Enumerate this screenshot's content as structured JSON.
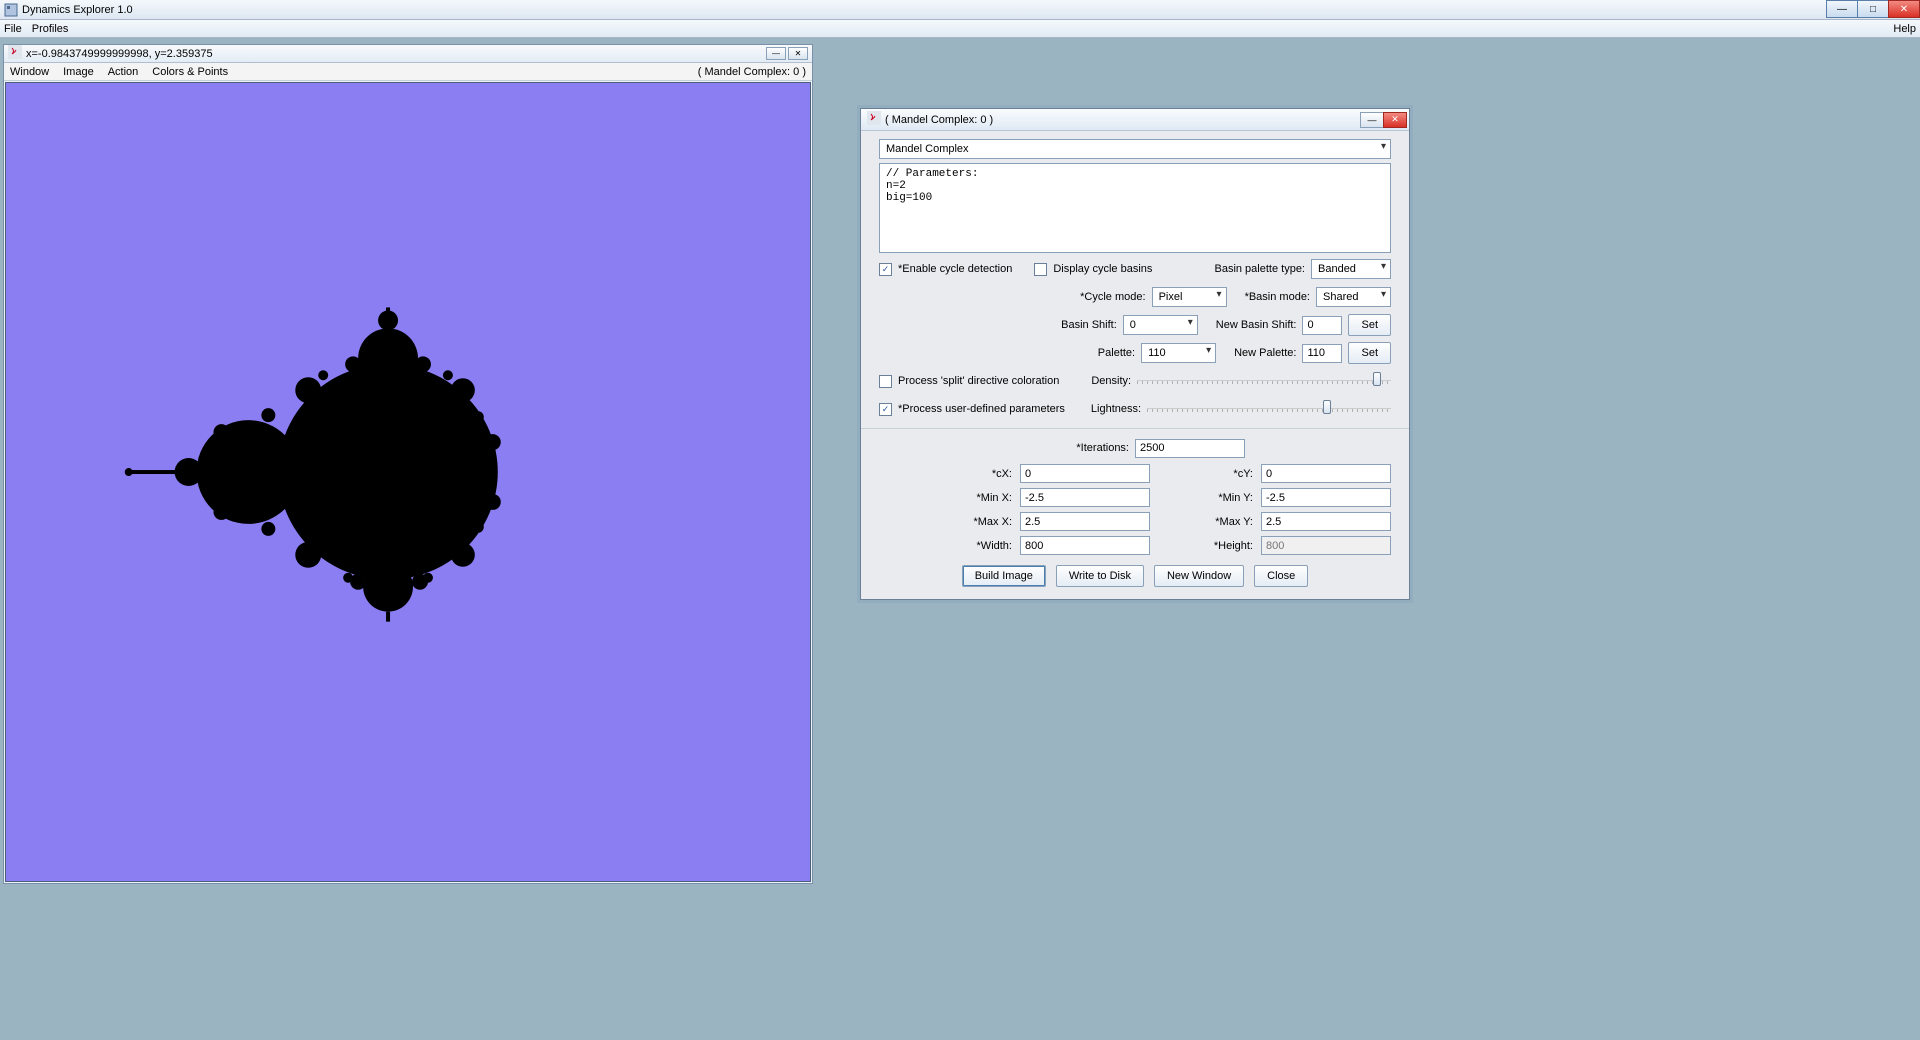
{
  "app": {
    "title": "Dynamics Explorer 1.0",
    "menu": {
      "file": "File",
      "profiles": "Profiles",
      "help": "Help"
    }
  },
  "viewer": {
    "coords": "x=-0.9843749999999998, y=2.359375",
    "menus": {
      "window": "Window",
      "image": "Image",
      "action": "Action",
      "colors": "Colors & Points"
    },
    "context": "( Mandel Complex: 0 )"
  },
  "dialog": {
    "title": "( Mandel Complex: 0 )",
    "mapping_select": "Mandel Complex",
    "parameters_code": "// Parameters:\nn=2\nbig=100",
    "enable_cycle_detection": {
      "label": "*Enable cycle detection",
      "checked": true
    },
    "display_cycle_basins": {
      "label": "Display cycle basins",
      "checked": false
    },
    "basin_palette_type": {
      "label": "Basin palette type:",
      "value": "Banded"
    },
    "cycle_mode": {
      "label": "*Cycle mode:",
      "value": "Pixel"
    },
    "basin_mode": {
      "label": "*Basin mode:",
      "value": "Shared"
    },
    "basin_shift": {
      "label": "Basin Shift:",
      "value": "0"
    },
    "new_basin_shift": {
      "label": "New Basin Shift:",
      "value": "0",
      "set": "Set"
    },
    "palette": {
      "label": "Palette:",
      "value": "110"
    },
    "new_palette": {
      "label": "New Palette:",
      "value": "110",
      "set": "Set"
    },
    "process_split": {
      "label": "Process 'split' directive coloration",
      "checked": false
    },
    "process_user_params": {
      "label": "*Process user-defined parameters",
      "checked": true
    },
    "density": {
      "label": "Density:"
    },
    "lightness": {
      "label": "Lightness:"
    },
    "iterations": {
      "label": "*Iterations:",
      "value": "2500"
    },
    "cX": {
      "label": "*cX:",
      "value": "0"
    },
    "cY": {
      "label": "*cY:",
      "value": "0"
    },
    "minX": {
      "label": "*Min X:",
      "value": "-2.5"
    },
    "minY": {
      "label": "*Min Y:",
      "value": "-2.5"
    },
    "maxX": {
      "label": "*Max X:",
      "value": "2.5"
    },
    "maxY": {
      "label": "*Max Y:",
      "value": "2.5"
    },
    "width": {
      "label": "*Width:",
      "value": "800"
    },
    "height": {
      "label": "*Height:",
      "value": "800"
    },
    "buttons": {
      "build": "Build Image",
      "write": "Write to Disk",
      "newwin": "New Window",
      "close": "Close"
    }
  }
}
